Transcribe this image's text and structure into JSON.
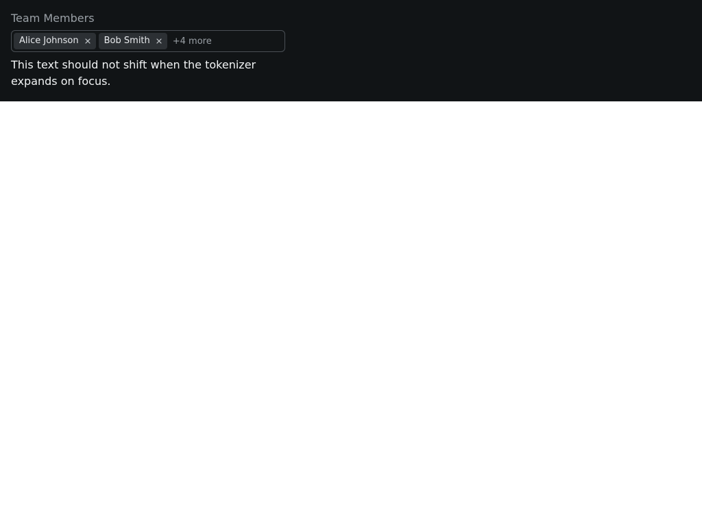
{
  "field": {
    "label": "Team Members"
  },
  "tokens": [
    {
      "label": "Alice Johnson",
      "remove_icon": "close-icon"
    },
    {
      "label": "Bob Smith",
      "remove_icon": "close-icon"
    }
  ],
  "overflow": {
    "label": "+4 more"
  },
  "helper_text": "This text should not shift when the tokenizer expands on focus.",
  "colors": {
    "panel_background": "#111416",
    "token_background": "#2c3034",
    "muted_text": "#9aa0a6",
    "primary_text": "#f1f3f4"
  }
}
